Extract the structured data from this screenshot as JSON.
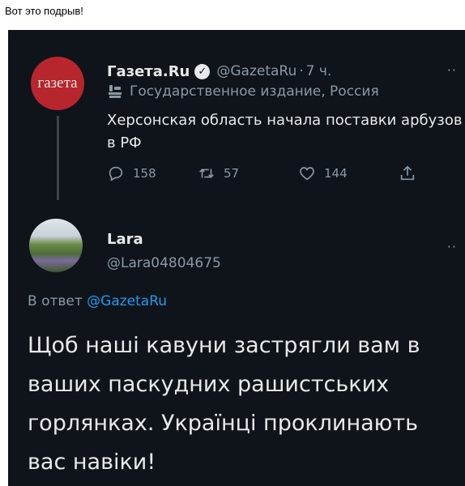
{
  "post": {
    "caption": "Вот это подрыв!"
  },
  "tweet1": {
    "avatar_text": "газета",
    "name": "Газета.Ru",
    "handle": "@GazetaRu",
    "dot": "·",
    "time": "7 ч.",
    "label": "Государственное издание, Россия",
    "text": "Херсонская область начала поставки арбузов в РФ",
    "replies": "158",
    "retweets": "57",
    "likes": "144"
  },
  "tweet2": {
    "name": "Lara",
    "handle": "@Lara04804675",
    "reply_prefix": "В ответ",
    "reply_to": "@GazetaRu",
    "text": "Щоб наші кавуни застрягли вам в ваших паскудних рашистських горлянках. Українці проклинають вас навіки!"
  },
  "icons": {
    "verified": "verified-badge-icon",
    "label": "state-media-flag-icon",
    "reply": "reply-icon",
    "retweet": "retweet-icon",
    "like": "heart-icon",
    "share": "share-icon",
    "more": "more-icon"
  },
  "colors": {
    "background": "#0e1419",
    "text": "#e7e9ea",
    "muted": "#8b98a5",
    "link": "#1d9bf0",
    "gazeta_red": "#b8262d"
  }
}
